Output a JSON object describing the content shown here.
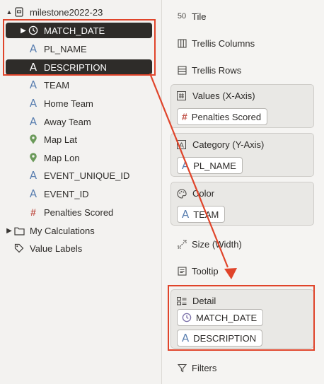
{
  "left_panel": {
    "dataset": "milestone2022-23",
    "fields": [
      {
        "label": "MATCH_DATE",
        "icon": "clock-icon",
        "selected": true
      },
      {
        "label": "PL_NAME",
        "icon": "attribute-a-icon",
        "selected": false
      },
      {
        "label": "DESCRIPTION",
        "icon": "attribute-a-icon",
        "selected": true
      },
      {
        "label": "TEAM",
        "icon": "attribute-a-icon"
      },
      {
        "label": "Home Team",
        "icon": "attribute-a-icon"
      },
      {
        "label": "Away Team",
        "icon": "attribute-a-icon"
      },
      {
        "label": "Map Lat",
        "icon": "map-pin-icon"
      },
      {
        "label": "Map Lon",
        "icon": "map-pin-icon"
      },
      {
        "label": "EVENT_UNIQUE_ID",
        "icon": "attribute-a-icon"
      },
      {
        "label": "EVENT_ID",
        "icon": "attribute-a-icon"
      },
      {
        "label": "Penalties Scored",
        "icon": "hash-icon"
      }
    ],
    "my_calculations": "My Calculations",
    "value_labels": "Value Labels"
  },
  "grammar_panel": {
    "tile": "Tile",
    "trellis_columns": "Trellis Columns",
    "trellis_rows": "Trellis Rows",
    "values_section": {
      "title": "Values (X-Axis)",
      "pill": "Penalties Scored"
    },
    "category_section": {
      "title": "Category (Y-Axis)",
      "pill": "PL_NAME"
    },
    "color_section": {
      "title": "Color",
      "pill": "TEAM"
    },
    "size": "Size (Width)",
    "tooltip": "Tooltip",
    "detail_section": {
      "title": "Detail",
      "pills": [
        "MATCH_DATE",
        "DESCRIPTION"
      ]
    },
    "filters": "Filters"
  },
  "colors": {
    "highlight": "#e0442a",
    "attribute": "#5a7fb0",
    "measure": "#c1544a",
    "location": "#6b9a5a",
    "selected_bg": "#2e2c29"
  }
}
